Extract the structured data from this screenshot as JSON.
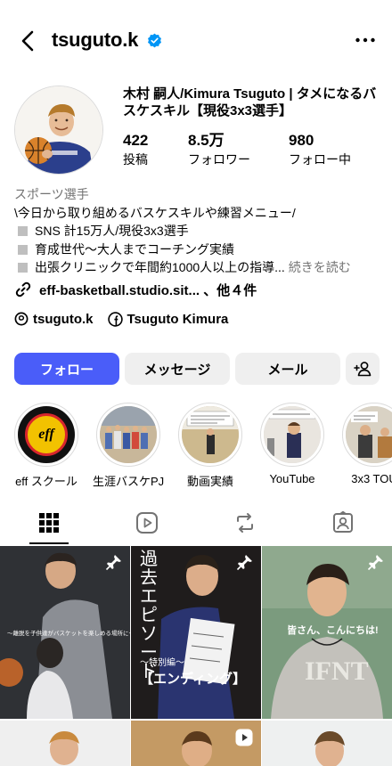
{
  "header": {
    "username": "tsuguto.k",
    "back_icon": "chevron-left-icon",
    "verified_icon": "verified-badge-icon",
    "more_icon": "more-horizontal-icon"
  },
  "profile": {
    "name": "木村 嗣人/Kimura Tsuguto | タメになるバスケスキル【現役3x3選手】",
    "stats": {
      "posts": {
        "value": "422",
        "label": "投稿"
      },
      "followers": {
        "value": "8.5万",
        "label": "フォロワー"
      },
      "following": {
        "value": "980",
        "label": "フォロー中"
      }
    }
  },
  "bio": {
    "category": "スポーツ選手",
    "lines": [
      "\\今日から取り組めるバスケスキルや練習メニュー/",
      "SNS 計15万人/現役3x3選手",
      "育成世代〜大人までコーチング実績",
      "出張クリニックで年間約1000人以上の指導..."
    ],
    "more_label": "続きを読む",
    "link": "eff-basketball.studio.sit... 、他４件",
    "threads": "tsuguto.k",
    "facebook": "Tsuguto Kimura"
  },
  "buttons": {
    "follow": "フォロー",
    "message": "メッセージ",
    "email": "メール",
    "add_user_icon": "add-person-icon"
  },
  "highlights": [
    {
      "label": "eff スクール",
      "badge": "eff"
    },
    {
      "label": "生涯バスケPJ"
    },
    {
      "label": "動画実績"
    },
    {
      "label": "YouTube"
    },
    {
      "label": "3x3 TOU"
    }
  ],
  "tabs": [
    "grid-icon",
    "reels-icon",
    "reposts-icon",
    "tagged-icon"
  ],
  "posts": [
    {
      "caption": "〜離脱を子供達がバスケットを楽しめる場所に〜"
    },
    {
      "title": "過去エピソード",
      "subtitle": "〜特別編〜",
      "tag": "【エンディング】"
    },
    {
      "caption": "皆さん、こんにちは!"
    }
  ],
  "colors": {
    "accent": "#4a5df9",
    "verified": "#0095f6",
    "button_bg": "#efefef",
    "muted": "#737373"
  }
}
